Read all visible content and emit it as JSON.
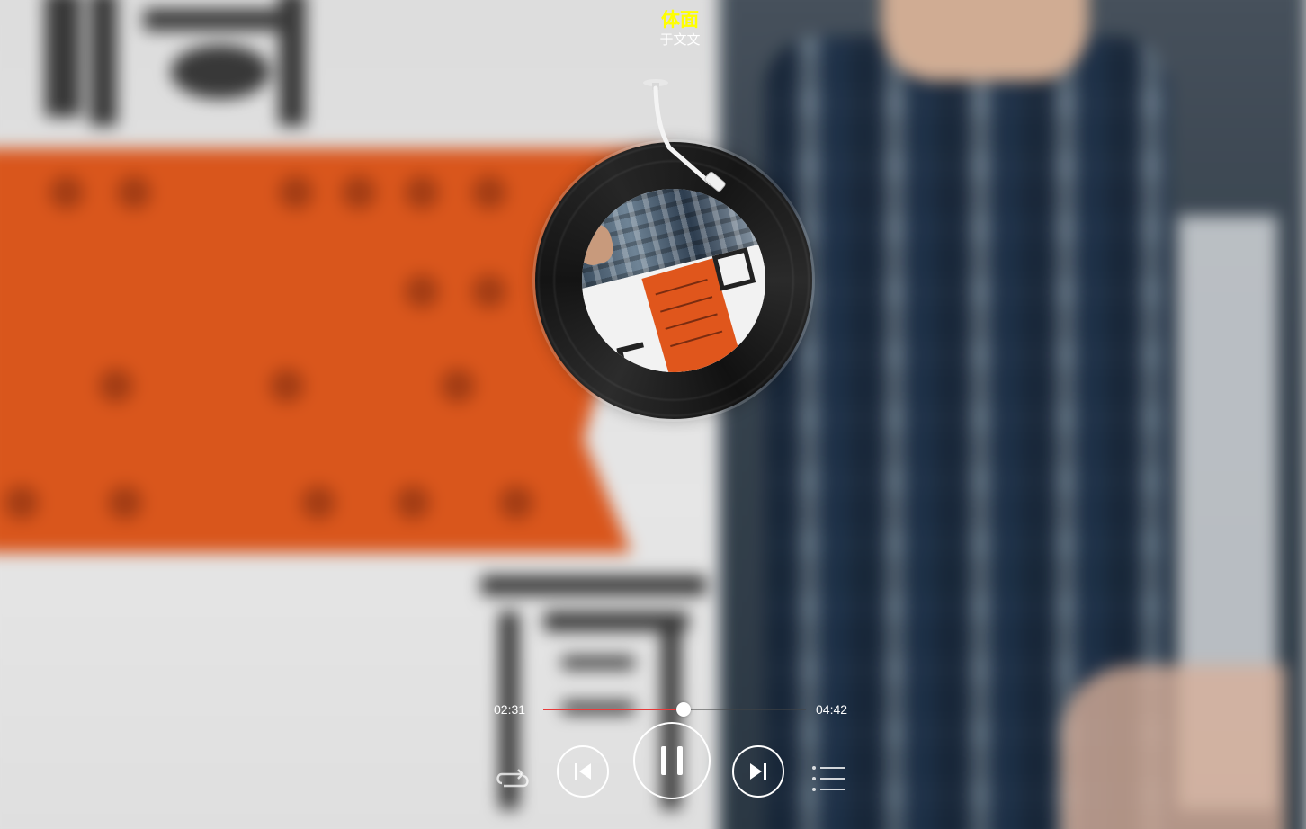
{
  "player": {
    "song_title": "体面",
    "artist": "于文文",
    "current_time": "02:31",
    "total_time": "04:42",
    "progress_fraction": 0.535,
    "state": "playing"
  },
  "controls": {
    "loop_icon": "loop-icon",
    "prev_icon": "previous-track-icon",
    "play_pause_icon": "pause-icon",
    "next_icon": "next-track-icon",
    "playlist_icon": "playlist-icon"
  },
  "colors": {
    "title": "#ffff00",
    "artist": "#ffffff",
    "progress_fill": "#e83a3a",
    "accent_orange": "#e25a1e"
  }
}
